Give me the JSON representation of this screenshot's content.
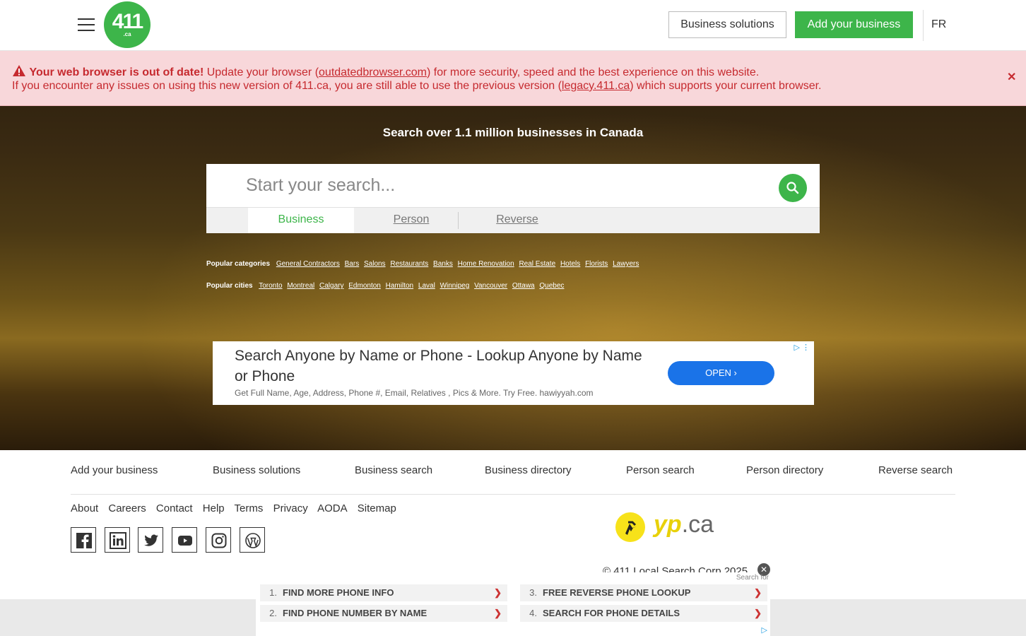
{
  "header": {
    "logo_number": "411",
    "logo_suffix": ".ca",
    "business_solutions": "Business solutions",
    "add_business": "Add your business",
    "lang": "FR"
  },
  "warning": {
    "title": "Your web browser is out of date!",
    "line1_pre": " Update your browser (",
    "line1_link": "outdatedbrowser.com",
    "line1_post": ") for more security, speed and the best experience on this website.",
    "line2_pre": "If you encounter any issues on using this new version of 411.ca, you are still able to use the previous version (",
    "line2_link": "legacy.411.ca",
    "line2_post": ") which supports your current browser.",
    "close": "✕"
  },
  "hero": {
    "subtitle": "Search over 1.1 million businesses in Canada",
    "search_placeholder": "Start your search...",
    "tabs": [
      "Business",
      "Person",
      "Reverse"
    ]
  },
  "popular": {
    "categories_label": "Popular categories",
    "categories": [
      "General Contractors",
      "Bars",
      "Salons",
      "Restaurants",
      "Banks",
      "Home Renovation",
      "Real Estate",
      "Hotels",
      "Florists",
      "Lawyers"
    ],
    "cities_label": "Popular cities",
    "cities": [
      "Toronto",
      "Montreal",
      "Calgary",
      "Edmonton",
      "Hamilton",
      "Laval",
      "Winnipeg",
      "Vancouver",
      "Ottawa",
      "Quebec"
    ]
  },
  "ad": {
    "title": "Search Anyone by Name or Phone - Lookup Anyone by Name or Phone",
    "description": "Get Full Name, Age, Address, Phone #, Email, Relatives , Pics & More. Try Free. hawiyyah.com",
    "button": "OPEN"
  },
  "footer": {
    "nav": [
      "Add your business",
      "Business solutions",
      "Business search",
      "Business directory",
      "Person search",
      "Person directory",
      "Reverse search"
    ],
    "links": [
      "About",
      "Careers",
      "Contact",
      "Help",
      "Terms",
      "Privacy",
      "AODA",
      "Sitemap"
    ],
    "social": [
      "facebook-icon",
      "linkedin-icon",
      "twitter-icon",
      "youtube-icon",
      "instagram-icon",
      "wordpress-icon"
    ],
    "yp_brand": "yp",
    "yp_suffix": ".ca",
    "copyright": "© 411 Local Search Corp 2025"
  },
  "bottom_ad": {
    "search_for": "Search for",
    "items": [
      {
        "num": "1.",
        "text": "FIND MORE PHONE INFO"
      },
      {
        "num": "3.",
        "text": "FREE REVERSE PHONE LOOKUP"
      },
      {
        "num": "2.",
        "text": "FIND PHONE NUMBER BY NAME"
      },
      {
        "num": "4.",
        "text": "SEARCH FOR PHONE DETAILS"
      }
    ]
  },
  "colors": {
    "brand_green": "#3db54a",
    "warning_red": "#c62a2f",
    "warning_bg": "#f8d7da",
    "yp_yellow": "#f7e21a"
  }
}
